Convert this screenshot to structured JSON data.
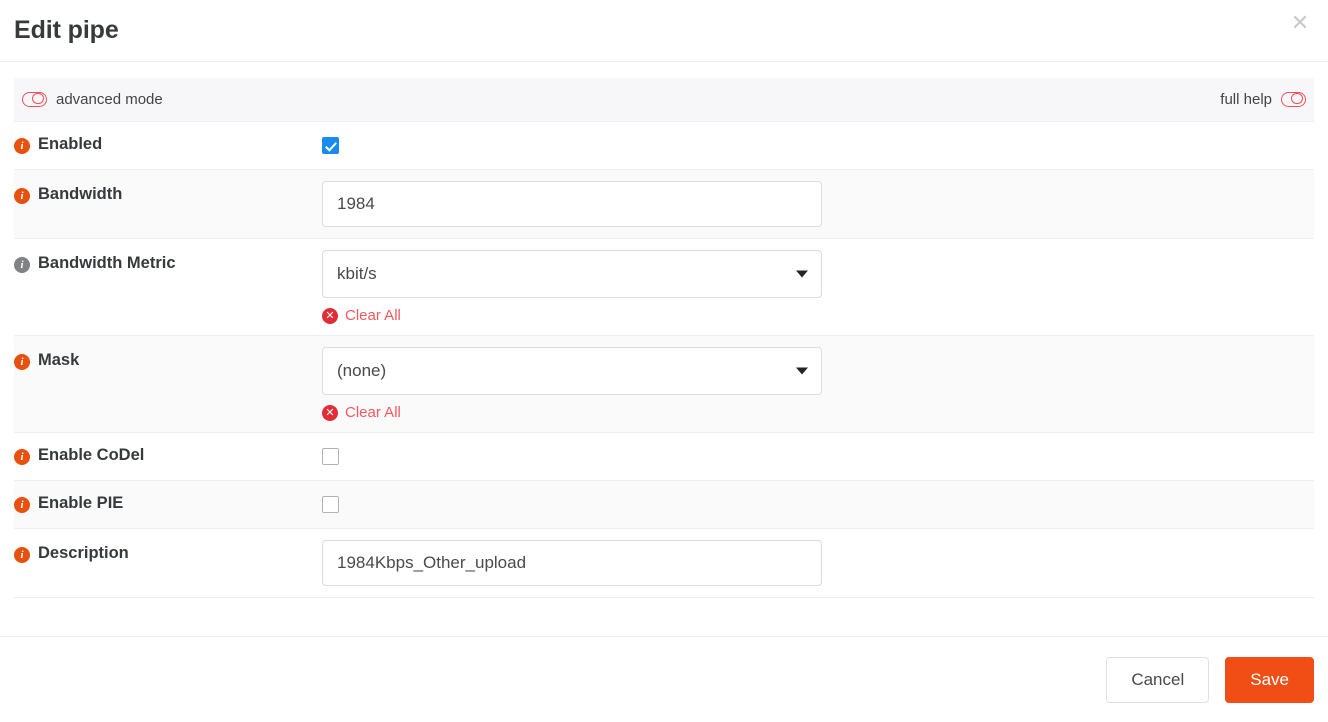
{
  "dialog": {
    "title": "Edit pipe",
    "close_icon": "close-icon"
  },
  "mode_bar": {
    "advanced_label": "advanced mode",
    "advanced_toggle_icon": "toggle-icon",
    "help_label": "full help",
    "help_toggle_icon": "toggle-icon"
  },
  "rows": {
    "enabled": {
      "label": "Enabled",
      "info_icon": "info-icon",
      "checked": true
    },
    "bandwidth": {
      "label": "Bandwidth",
      "info_icon": "info-icon",
      "value": "1984"
    },
    "bandwidth_metric": {
      "label": "Bandwidth Metric",
      "info_icon": "info-icon-muted",
      "value": "kbit/s",
      "caret_icon": "chevron-down-icon",
      "clear_all_label": "Clear All",
      "clear_all_icon": "clear-circle-icon"
    },
    "mask": {
      "label": "Mask",
      "info_icon": "info-icon",
      "value": "(none)",
      "caret_icon": "chevron-down-icon",
      "clear_all_label": "Clear All",
      "clear_all_icon": "clear-circle-icon"
    },
    "enable_codel": {
      "label": "Enable CoDel",
      "info_icon": "info-icon",
      "checked": false
    },
    "enable_pie": {
      "label": "Enable PIE",
      "info_icon": "info-icon",
      "checked": false
    },
    "description": {
      "label": "Description",
      "info_icon": "info-icon",
      "value": "1984Kbps_Other_upload"
    }
  },
  "footer": {
    "cancel_label": "Cancel",
    "save_label": "Save"
  },
  "colors": {
    "accent": "#f04e14",
    "info_icon": "#e8500e",
    "info_icon_muted": "#808284",
    "toggle": "#f0515b",
    "clear_link": "#f3595f",
    "clear_icon": "#e22d36",
    "checkbox_checked": "#1a8cf0",
    "row_stripe": "#fafafa",
    "border": "#eceeef"
  }
}
